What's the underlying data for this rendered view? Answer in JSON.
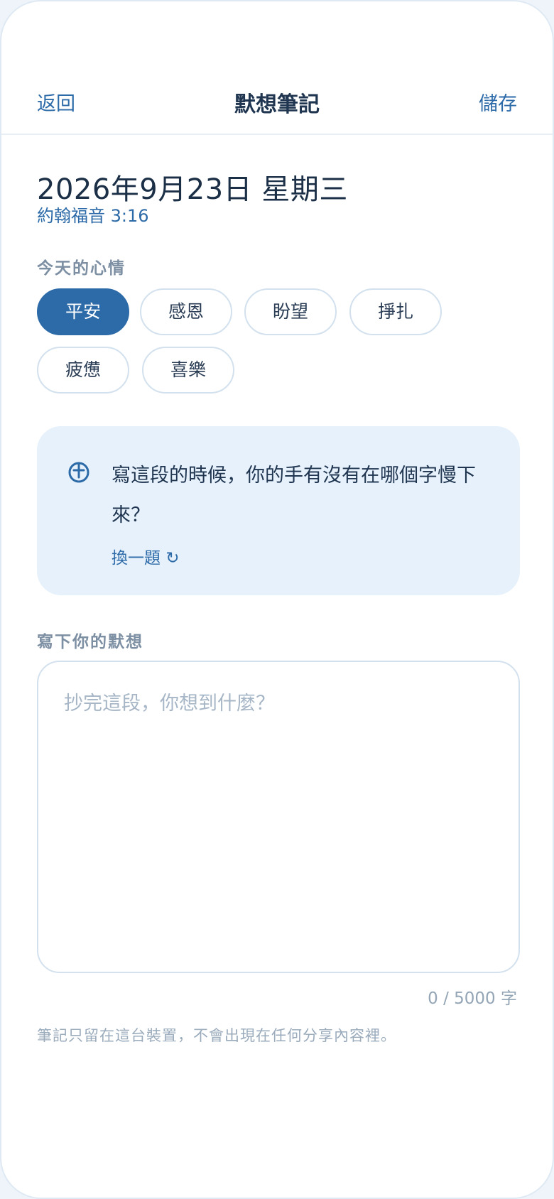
{
  "header": {
    "back_label": "返回",
    "title": "默想筆記",
    "save_label": "儲存"
  },
  "entry": {
    "date": "2026年9月23日 星期三",
    "verse": "約翰福音 3:16"
  },
  "mood": {
    "label": "今天的心情",
    "selected": "平安",
    "options": [
      "平安",
      "感恩",
      "盼望",
      "掙扎",
      "疲憊",
      "喜樂"
    ]
  },
  "prompt": {
    "icon": "hand-pen-icon",
    "text": "寫這段的時候，你的手有沒有在哪個字慢下來？",
    "shuffle_label": "換一題 ↻"
  },
  "notes": {
    "label": "寫下你的默想",
    "value": "",
    "placeholder": "抄完這段，你想到什麼？",
    "counter": "0 / 5000 字"
  },
  "footnote": "筆記只留在這台裝置，不會出現在任何分享內容裡。",
  "colors": {
    "accent": "#2c6aa8",
    "card_bg": "#e6f1fb",
    "text": "#1f3550"
  }
}
